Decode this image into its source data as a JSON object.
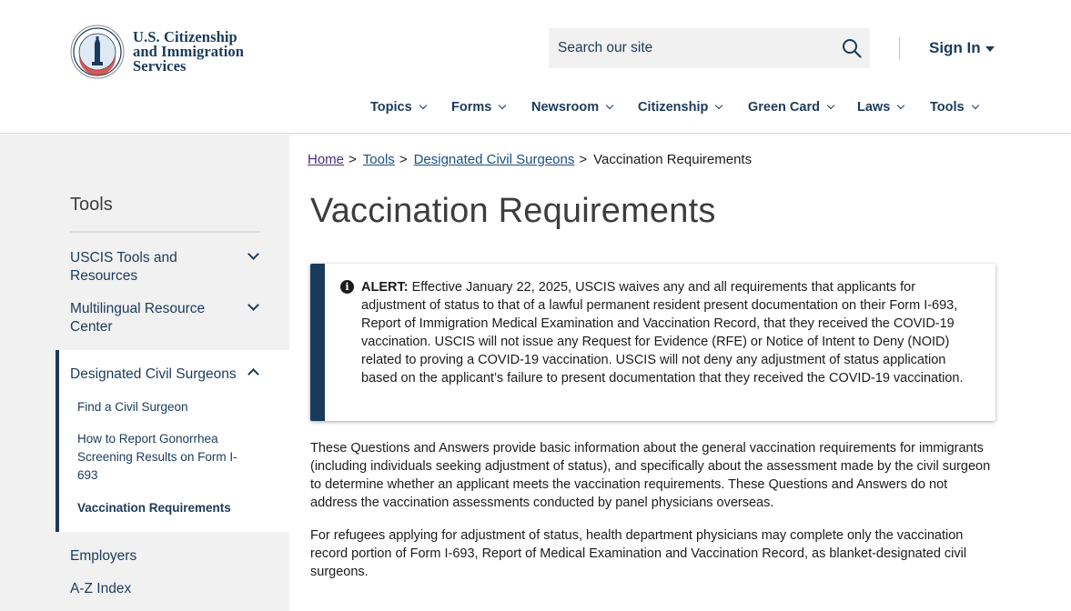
{
  "header": {
    "logo_lines": [
      "U.S. Citizenship",
      "and Immigration",
      "Services"
    ],
    "search_placeholder": "Search our site",
    "signin_label": "Sign In"
  },
  "nav": {
    "items": [
      {
        "label": "Topics"
      },
      {
        "label": "Forms"
      },
      {
        "label": "Newsroom"
      },
      {
        "label": "Citizenship"
      },
      {
        "label": "Green Card"
      },
      {
        "label": "Laws"
      },
      {
        "label": "Tools"
      }
    ]
  },
  "sidebar": {
    "title": "Tools",
    "items": [
      {
        "label_lines": [
          "USCIS Tools and",
          "Resources"
        ]
      },
      {
        "label_lines": [
          "Multilingual Resource",
          "Center"
        ]
      },
      {
        "label": "Designated Civil Surgeons"
      },
      {
        "label": "Employers"
      },
      {
        "label": "A-Z Index"
      }
    ],
    "sub_items": [
      {
        "label_lines": [
          "Find a Civil Surgeon"
        ]
      },
      {
        "label_lines": [
          "How to Report Gonorrhea",
          "Screening Results on Form I-",
          "693"
        ]
      },
      {
        "label_lines": [
          "Vaccination Requirements"
        ]
      }
    ]
  },
  "breadcrumb": {
    "home": "Home",
    "tools": "Tools",
    "surgeons": "Designated Civil Surgeons",
    "current": "Vaccination Requirements",
    "sep": ">"
  },
  "page_title": "Vaccination Requirements",
  "alert": {
    "icon": "info-icon",
    "label": "ALERT:",
    "text": " Effective January 22, 2025, USCIS waives any and all requirements that applicants for adjustment of status to that of a lawful permanent resident present documentation on their Form I-693, Report of Immigration Medical Examination and Vaccination Record, that they received the COVID-19 vaccination. USCIS will not issue any Request for Evidence (RFE) or Notice of Intent to Deny (NOID) related to proving a COVID-19 vaccination.  USCIS will not deny any adjustment of status application based on the applicant’s failure to present documentation that they received the COVID-19 vaccination."
  },
  "paragraphs": [
    "These Questions and Answers provide basic information about the general vaccination requirements for immigrants (including individuals seeking adjustment of status), and specifically about the assessment made by the civil surgeon to determine whether an applicant meets the vaccination requirements. These Questions and Answers do not address the vaccination assessments conducted by panel physicians overseas.",
    "For refugees applying for adjustment of status, health department physicians may complete only the vaccination record portion of Form I-693, Report of Medical Examination and Vaccination Record, as blanket-designated civil surgeons."
  ],
  "colors": {
    "brand_navy": "#1a3a5c",
    "link": "#1a4f80",
    "link_visited": "#4c2c7a",
    "sidebar_bg": "#f1f1f1"
  }
}
